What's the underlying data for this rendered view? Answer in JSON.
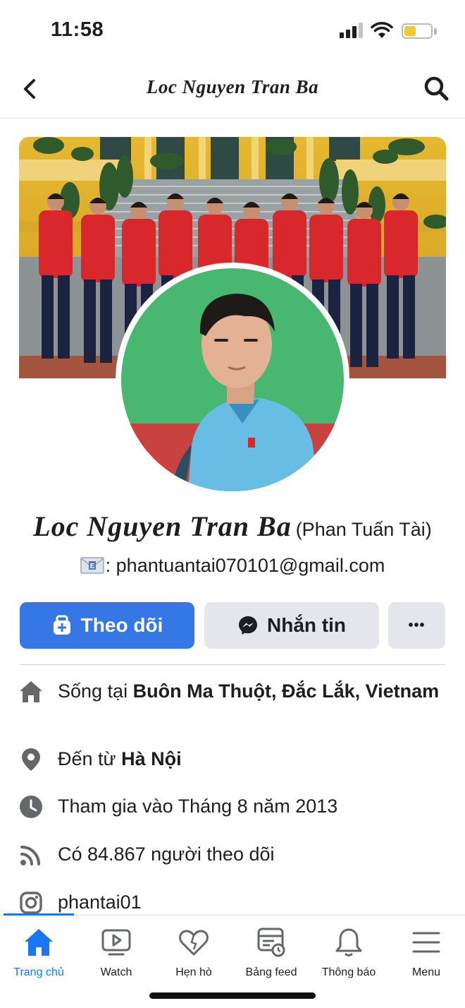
{
  "status_bar": {
    "time": "11:58",
    "battery_level": 0.45,
    "battery_color": "#f3c836"
  },
  "header": {
    "title": "Loc Nguyen Tran Ba",
    "back_icon": "chevron-left-icon",
    "search_icon": "search-icon"
  },
  "profile": {
    "name": "Loc Nguyen Tran Ba",
    "alternate_name": "(Phan Tuấn Tài)",
    "bio_text": ": phantuantai070101@gmail.com",
    "bio_icon": "envelope-e-emoji"
  },
  "actions": {
    "follow_label": "Theo dõi",
    "message_label": "Nhắn tin",
    "more_label": "•••",
    "accent_color": "#3578e5"
  },
  "info": {
    "lives_prefix": "Sống tại",
    "lives_place": "Buôn Ma Thuột, Đắc Lắk, Vietnam",
    "from_prefix": "Đến từ",
    "from_place": "Hà Nội",
    "joined": "Tham gia vào Tháng 8 năm 2013",
    "followers": "Có 84.867 người theo dõi",
    "instagram": "phantai01"
  },
  "tabs": [
    {
      "label": "Trang chủ",
      "icon": "home-icon",
      "active": true
    },
    {
      "label": "Watch",
      "icon": "video-icon",
      "active": false
    },
    {
      "label": "Hẹn hò",
      "icon": "heart-icon",
      "active": false
    },
    {
      "label": "Bảng feed",
      "icon": "feed-icon",
      "active": false
    },
    {
      "label": "Thông báo",
      "icon": "bell-icon",
      "active": false
    },
    {
      "label": "Menu",
      "icon": "menu-icon",
      "active": false
    }
  ],
  "colors": {
    "active_tab": "#1877f2",
    "icon_gray": "#65676b"
  }
}
